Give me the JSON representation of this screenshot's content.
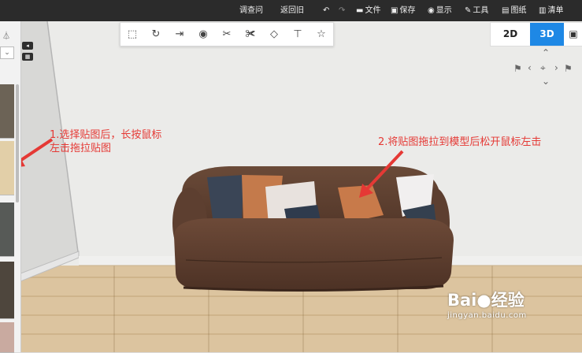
{
  "topbar": {
    "items": [
      {
        "label": "调查问",
        "icon": ""
      },
      {
        "label": "返回旧",
        "icon": ""
      },
      {
        "label": "",
        "icon": "undo-icon"
      },
      {
        "label": "",
        "icon": "redo-icon"
      },
      {
        "label": "文件",
        "icon": "folder-icon"
      },
      {
        "label": "保存",
        "icon": "save-icon"
      },
      {
        "label": "显示",
        "icon": "eye-icon"
      },
      {
        "label": "工具",
        "icon": "wrench-icon"
      },
      {
        "label": "图纸",
        "icon": "map-icon"
      },
      {
        "label": "清单",
        "icon": "list-icon"
      }
    ]
  },
  "toolbar": {
    "tools": [
      "select-icon",
      "replace-icon",
      "exit-icon",
      "eye-icon",
      "cut-icon",
      "split-icon",
      "eraser-icon",
      "paint-roller-icon",
      "star-icon"
    ]
  },
  "view": {
    "label_2d": "2D",
    "label_3d": "3D",
    "active": "3D",
    "accent": "#1e88e5"
  },
  "annotations": {
    "step1_line1": "1.选择贴图后，长按鼠标",
    "step1_line2": "左击拖拉贴图",
    "step2": "2.将贴图拖拉到模型后松开鼠标左击",
    "color": "#e53935"
  },
  "watermark": {
    "title": "Bai●经验",
    "url": "jingyan.baidu.com"
  }
}
